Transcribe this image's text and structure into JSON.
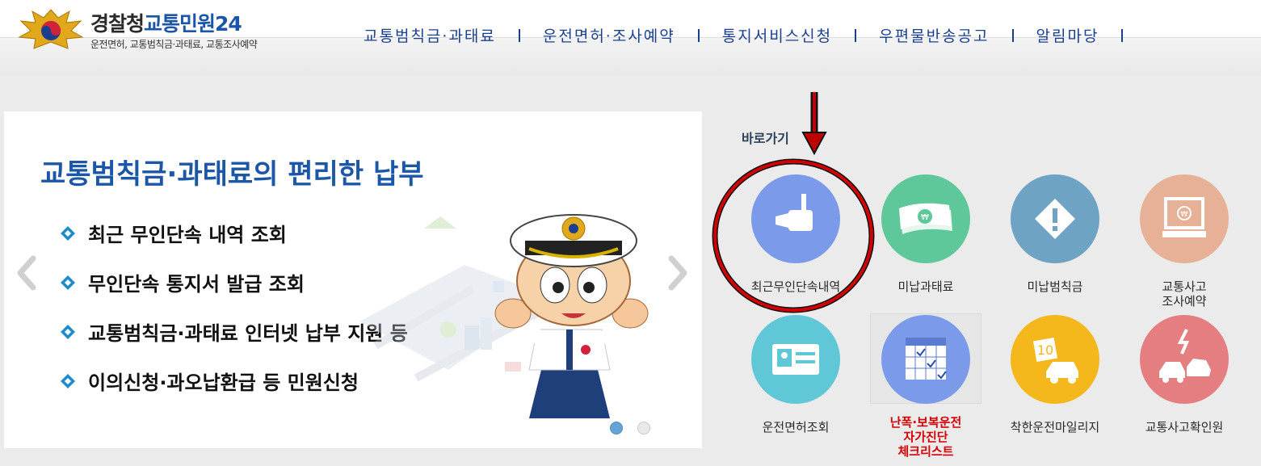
{
  "header": {
    "logo_title_dark": "경찰청",
    "logo_title_blue": "교통민원24",
    "logo_subtitle": "운전면허, 교통범칙금·과태료, 교통조사예약",
    "nav": [
      {
        "label": "교통범칙금·과태료"
      },
      {
        "label": "운전면허·조사예약"
      },
      {
        "label": "통지서비스신청"
      },
      {
        "label": "우편물반송공고"
      },
      {
        "label": "알림마당"
      }
    ]
  },
  "banner": {
    "title": "교통범칙금·과태료의 편리한 납부",
    "bullets": [
      {
        "text": "최근 무인단속 내역 조회"
      },
      {
        "text": "무인단속 통지서 발급 조회"
      },
      {
        "text": "교통범칙금·과태료 인터넷 납부 지원 등"
      },
      {
        "text": "이의신청·과오납환급 등 민원신청"
      }
    ],
    "slide_total": 2,
    "slide_active": 1
  },
  "quick": {
    "label": "바로가기",
    "items": [
      {
        "label": "최근무인단속내역",
        "icon": "camera-icon",
        "color": "#7b9bea"
      },
      {
        "label": "미납과태료",
        "icon": "money-icon",
        "color": "#5fc89a"
      },
      {
        "label": "미납범칙금",
        "icon": "warning-icon",
        "color": "#6fa3c4"
      },
      {
        "label": "교통사고\n조사예약",
        "icon": "computer-icon",
        "color": "#e6b197"
      },
      {
        "label": "운전면허조회",
        "icon": "license-card-icon",
        "color": "#5fc7d6"
      },
      {
        "label": "난폭·보복운전\n자가진단\n체크리스트",
        "icon": "calendar-check-icon",
        "color": "#7b9bea"
      },
      {
        "label": "착한운전마일리지",
        "icon": "mileage-icon",
        "color": "#f5b81c"
      },
      {
        "label": "교통사고확인원",
        "icon": "accident-icon",
        "color": "#e47e80"
      }
    ]
  },
  "mileage_badge": "10"
}
